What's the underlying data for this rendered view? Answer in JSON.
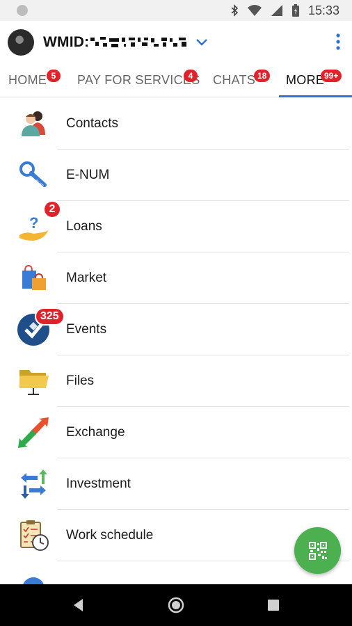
{
  "status_bar": {
    "time": "15:33"
  },
  "header": {
    "wmid_label": "WMID:"
  },
  "tabs": [
    {
      "label": "HOME",
      "badge": "5"
    },
    {
      "label": "PAY FOR SERVICES",
      "badge": "4"
    },
    {
      "label": "CHATS",
      "badge": "18"
    },
    {
      "label": "MORE",
      "badge": "99+"
    }
  ],
  "active_tab": "MORE",
  "menu": [
    {
      "label": "Contacts",
      "icon": "contacts-icon",
      "badge": ""
    },
    {
      "label": "E-NUM",
      "icon": "enum-key-icon",
      "badge": ""
    },
    {
      "label": "Loans",
      "icon": "loans-hand-icon",
      "badge": "2"
    },
    {
      "label": "Market",
      "icon": "shopping-bags-icon",
      "badge": ""
    },
    {
      "label": "Events",
      "icon": "events-icon",
      "badge": "325"
    },
    {
      "label": "Files",
      "icon": "folder-icon",
      "badge": ""
    },
    {
      "label": "Exchange",
      "icon": "exchange-arrows-icon",
      "badge": ""
    },
    {
      "label": "Investment",
      "icon": "investment-arrows-icon",
      "badge": ""
    },
    {
      "label": "Work schedule",
      "icon": "clipboard-clock-icon",
      "badge": ""
    }
  ],
  "colors": {
    "accent": "#2f6fd7",
    "badge": "#e1222a",
    "fab": "#4caf50"
  }
}
